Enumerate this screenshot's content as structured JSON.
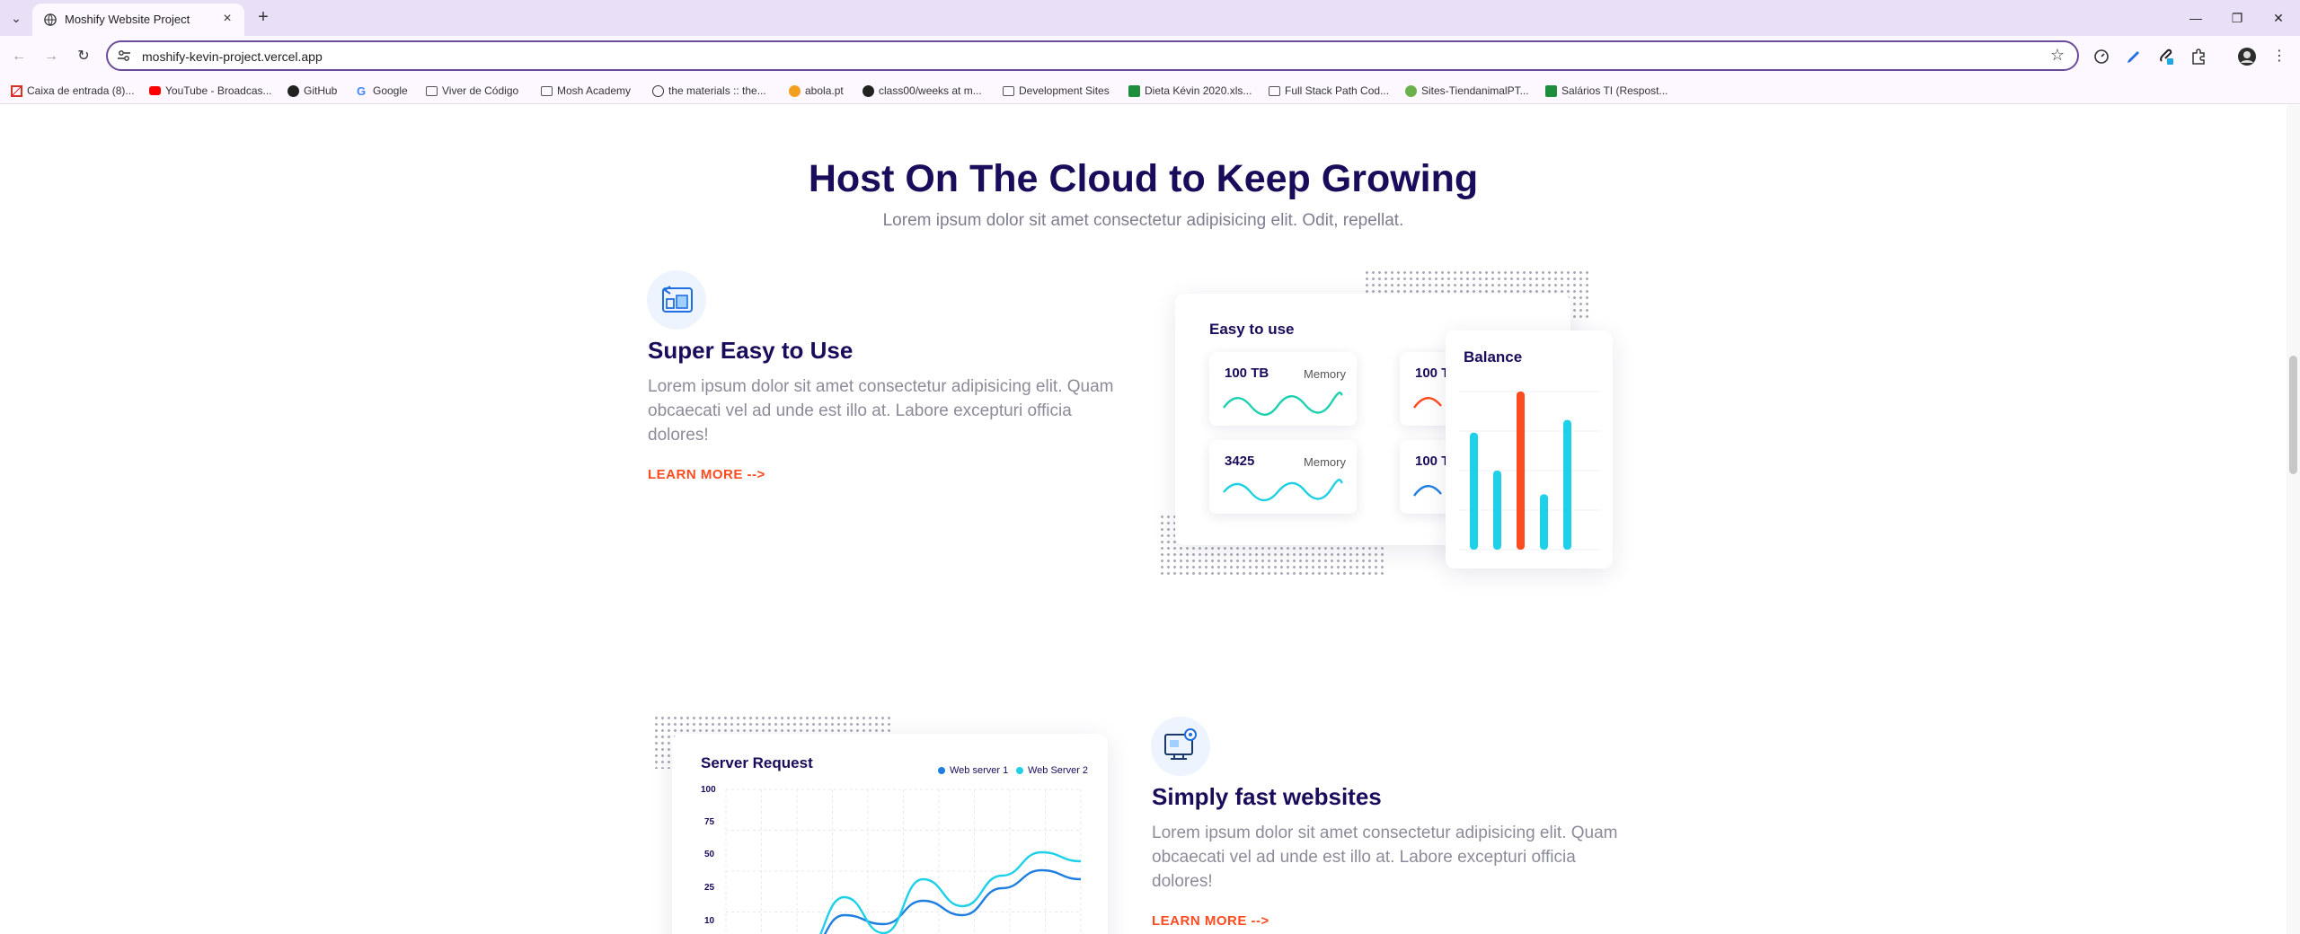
{
  "browser": {
    "tab": {
      "title": "Moshify Website Project"
    },
    "url": "moshify-kevin-project.vercel.app",
    "bookmarks": [
      {
        "label": "Caixa de entrada (8)...",
        "icon": "gmail-icon",
        "color": "#d93025"
      },
      {
        "label": "YouTube - Broadcas...",
        "icon": "youtube-icon",
        "color": "#ff0000"
      },
      {
        "label": "GitHub",
        "icon": "github-icon",
        "color": "#222222"
      },
      {
        "label": "Google",
        "icon": "google-icon",
        "color": "#4285f4"
      },
      {
        "label": "Viver de Código",
        "icon": "folder-icon",
        "color": "#555555"
      },
      {
        "label": "Mosh Academy",
        "icon": "folder-icon",
        "color": "#555555"
      },
      {
        "label": "the materials :: the...",
        "icon": "globe-icon",
        "color": "#333333"
      },
      {
        "label": "abola.pt",
        "icon": "abola-icon",
        "color": "#f2a01f"
      },
      {
        "label": "class00/weeks at m...",
        "icon": "github-icon",
        "color": "#222222"
      },
      {
        "label": "Development Sites",
        "icon": "folder-icon",
        "color": "#555555"
      },
      {
        "label": "Dieta Kévin 2020.xls...",
        "icon": "sheets-icon",
        "color": "#1e8e3e"
      },
      {
        "label": "Full Stack Path Cod...",
        "icon": "folder-icon",
        "color": "#555555"
      },
      {
        "label": "Sites-TiendanimalPT...",
        "icon": "paw-icon",
        "color": "#6ab04c"
      },
      {
        "label": "Salários TI (Respost...",
        "icon": "sheets-icon",
        "color": "#1e8e3e"
      }
    ]
  },
  "page": {
    "title": "Host On The Cloud to Keep Growing",
    "subtitle": "Lorem ipsum dolor sit amet consectetur adipisicing elit. Odit, repellat.",
    "features": [
      {
        "title": "Super Easy to Use",
        "text": "Lorem ipsum dolor sit amet consectetur adipisicing elit. Quam obcaecati vel ad unde est illo at. Labore excepturi officia dolores!",
        "link": "LEARN MORE -->"
      },
      {
        "title": "Simply fast websites",
        "text": "Lorem ipsum dolor sit amet consectetur adipisicing elit. Quam obcaecati vel ad unde est illo at. Labore excepturi officia dolores!",
        "link": "LEARN MORE -->"
      }
    ],
    "easy_card": {
      "title": "Easy to use",
      "minis": [
        {
          "value": "100 TB",
          "label": "Memory",
          "color": "#1fd1b0"
        },
        {
          "value": "100 T",
          "label": "",
          "color": "#ff4b1f"
        },
        {
          "value": "3425",
          "label": "Memory",
          "color": "#1fd1e0"
        },
        {
          "value": "100 T",
          "label": "",
          "color": "#1f7fe0"
        }
      ]
    },
    "balance_card": {
      "title": "Balance",
      "bars": [
        0.74,
        0.5,
        1.0,
        0.35,
        0.82
      ],
      "bar_colors": [
        "#1fd1e8",
        "#1fd1e8",
        "#ff4b1f",
        "#1fd1e8",
        "#1fd1e8"
      ]
    },
    "server_card": {
      "title": "Server Request",
      "legend": [
        {
          "name": "Web server 1",
          "color": "#1f7fe0"
        },
        {
          "name": "Web Server 2",
          "color": "#1fd1e8"
        }
      ],
      "yticks": [
        "100",
        "75",
        "50",
        "25",
        "10"
      ]
    }
  },
  "chart_data": {
    "type": "line",
    "title": "Server Request",
    "ylim": [
      0,
      100
    ],
    "yticks": [
      100,
      75,
      50,
      25,
      10
    ],
    "series": [
      {
        "name": "Web server 1",
        "values": [
          5,
          15,
          8,
          30,
          25,
          38,
          30,
          45,
          55,
          50
        ]
      },
      {
        "name": "Web Server 2",
        "values": [
          6,
          18,
          10,
          40,
          20,
          50,
          35,
          52,
          65,
          60
        ]
      }
    ]
  }
}
